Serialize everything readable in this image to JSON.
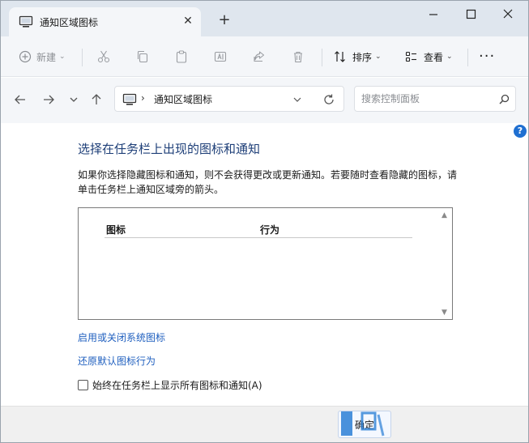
{
  "window": {
    "tab_title": "通知区域图标",
    "tab_close": "✕",
    "new_tab": "+"
  },
  "toolbar": {
    "new_label": "新建",
    "sort_label": "排序",
    "view_label": "查看",
    "more": "···"
  },
  "address": {
    "separator": "›",
    "breadcrumb": "通知区域图标"
  },
  "search": {
    "placeholder": "搜索控制面板"
  },
  "content": {
    "help": "?",
    "heading": "选择在任务栏上出现的图标和通知",
    "description": "如果你选择隐藏图标和通知，则不会获得更改或更新通知。若要随时查看隐藏的图标，请单击任务栏上通知区域旁的箭头。",
    "columns": [
      "图标",
      "行为"
    ],
    "link_system_icons": "启用或关闭系统图标",
    "link_restore": "还原默认图标行为",
    "checkbox_label": "始终在任务栏上显示所有图标和通知(A)",
    "checkbox_checked": false
  },
  "footer": {
    "ok_label": "确定"
  },
  "colors": {
    "heading": "#1e3f78",
    "link": "#1f5fbf",
    "accent": "#1f6fd1"
  }
}
